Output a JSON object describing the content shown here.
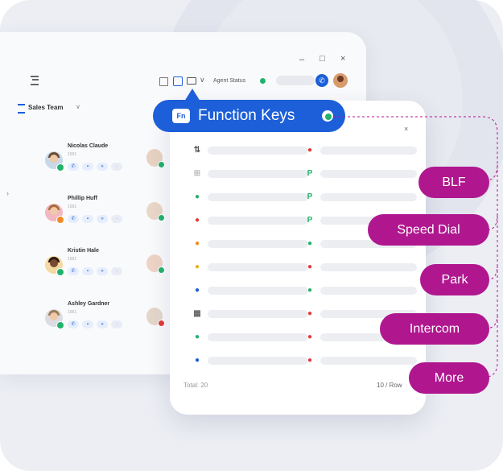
{
  "window": {
    "controls": [
      "–",
      "□",
      "×"
    ],
    "agent_status_label": "Agent Status",
    "team_label": "Sales Team",
    "colors": {
      "brand": "#1c5fd8",
      "online": "#23b26b",
      "away": "#f08a24",
      "busy": "#e23b3b",
      "accent_pill": "#b0178f"
    }
  },
  "contacts": [
    {
      "name": "Nicolas Claude",
      "ext": "1001",
      "status": "online"
    },
    {
      "name": "Phillip Huff",
      "ext": "1001",
      "status": "away"
    },
    {
      "name": "Kristin Hale",
      "ext": "1001",
      "status": "online"
    },
    {
      "name": "Ashley Gardner",
      "ext": "1001",
      "status": "online"
    }
  ],
  "function_keys": {
    "badge": "Fn",
    "title": "Function Keys",
    "total_label": "Total: 20",
    "rows_label": "10 / Row",
    "close": "×",
    "left_column_icons": [
      "sort-icon",
      "grid-icon",
      "user-green-icon",
      "user-red-icon",
      "user-orange-icon",
      "user-yellow-icon",
      "user-blue-icon",
      "calendar-icon",
      "group-green-icon",
      "group-blue-icon"
    ],
    "right_column_icons": [
      "user-red-icon",
      "P",
      "P",
      "P",
      "user-green-icon",
      "user-red-icon",
      "user-green-icon",
      "user-red-icon",
      "user-red-icon",
      "user-red-icon"
    ]
  },
  "feature_pills": [
    "BLF",
    "Speed Dial",
    "Park",
    "Intercom",
    "More"
  ]
}
